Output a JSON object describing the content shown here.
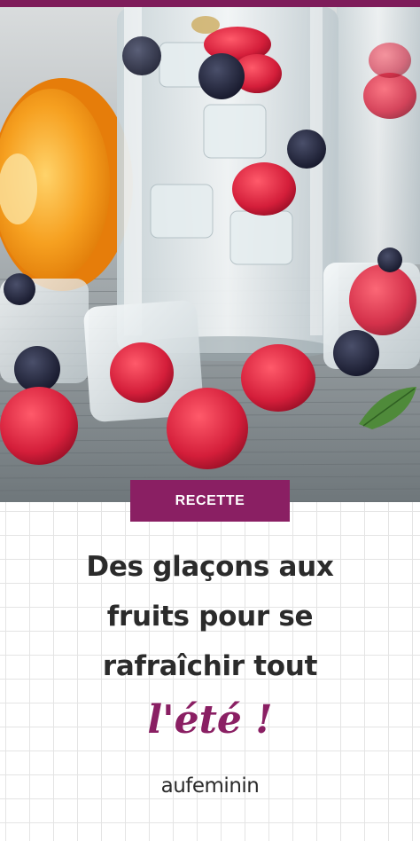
{
  "image": {
    "description_icons": [
      "orange-half-icon",
      "water-glass-icon",
      "ice-cube-icon",
      "raspberry-icon",
      "blueberry-icon",
      "mint-leaf-icon"
    ]
  },
  "colors": {
    "brand": "#8a1f63",
    "top_bar": "#7e1c5a",
    "headline_text": "#2b2b2b",
    "grid_line": "#e4e4e4"
  },
  "badge": {
    "label": "RECETTE"
  },
  "headline": {
    "line1": "Des glaçons aux",
    "line2": "fruits pour se",
    "line3": "rafraîchir tout"
  },
  "accent": {
    "text": "l'été !"
  },
  "logo": {
    "text": "aufeminin"
  }
}
